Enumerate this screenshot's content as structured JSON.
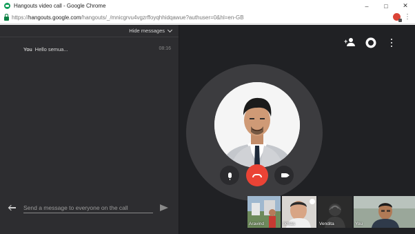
{
  "window": {
    "title": "Hangouts video call - Google Chrome",
    "minimize": "–",
    "maximize": "□",
    "close": "✕"
  },
  "address": {
    "url_prefix": "https://",
    "url_host": "hangouts.google.com",
    "url_path": "/hangouts/_/mnicgrvu4vgzrffoyqhhidqawue?authuser=0&hl=en-GB"
  },
  "chat": {
    "hide_label": "Hide messages",
    "messages": [
      {
        "sender": "You",
        "text": "Hello semua...",
        "time": "08:16"
      }
    ],
    "input_placeholder": "Send a message to everyone on the call"
  },
  "call": {
    "icons": [
      "add-person-icon",
      "gear-icon",
      "more-vert-icon"
    ],
    "end_color": "#ea4335"
  },
  "participants": [
    {
      "label": "Aravind"
    },
    {
      "label": "Ikhlas"
    },
    {
      "label": "Vendita"
    },
    {
      "label": "You"
    }
  ],
  "colors": {
    "background": "#202124",
    "chat_panel": "#2d2d30",
    "end_call": "#ea4335"
  }
}
